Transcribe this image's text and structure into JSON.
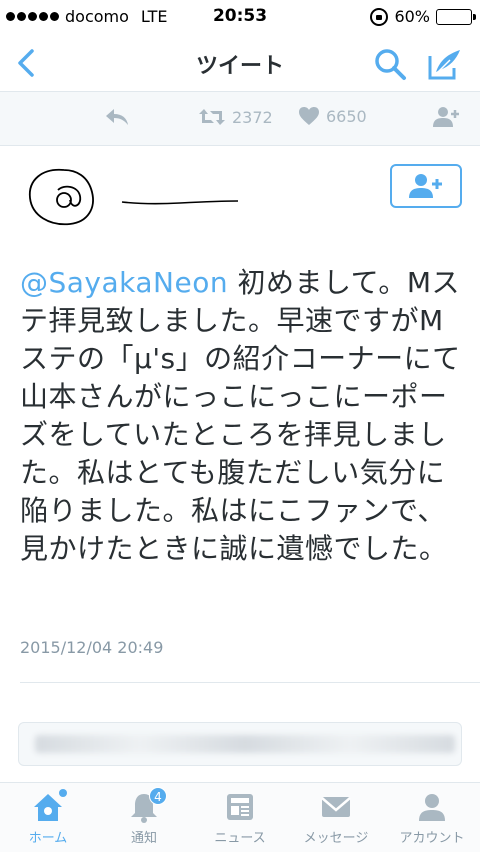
{
  "status_bar": {
    "carrier": "docomo",
    "network": "LTE",
    "time": "20:53",
    "battery": "60%",
    "battery_level": 0.6
  },
  "nav": {
    "title": "ツイート"
  },
  "actions": {
    "retweets": "2372",
    "likes": "6650"
  },
  "tweet": {
    "mention": "@SayakaNeon",
    "text": " 初めまして。Mステ拝見致しました。早速ですがMステの「μ's」の紹介コーナーにて山本さんがにっこにっこにーポーズをしていたところを拝見しました。私はとても腹ただしい気分に陥りました。私はにこファンで、見かけたときに誠に遺憾でした。",
    "date": "2015/12/04 20:49"
  },
  "tabs": [
    {
      "label": "ホーム",
      "icon": "home-icon",
      "active": true
    },
    {
      "label": "通知",
      "icon": "bell-icon",
      "badge": "4"
    },
    {
      "label": "ニュース",
      "icon": "news-icon"
    },
    {
      "label": "メッセージ",
      "icon": "envelope-icon"
    },
    {
      "label": "アカウント",
      "icon": "person-icon"
    }
  ],
  "colors": {
    "accent": "#55acee",
    "text": "#292f33",
    "muted": "#8899a6",
    "battery": "#4cd964"
  }
}
